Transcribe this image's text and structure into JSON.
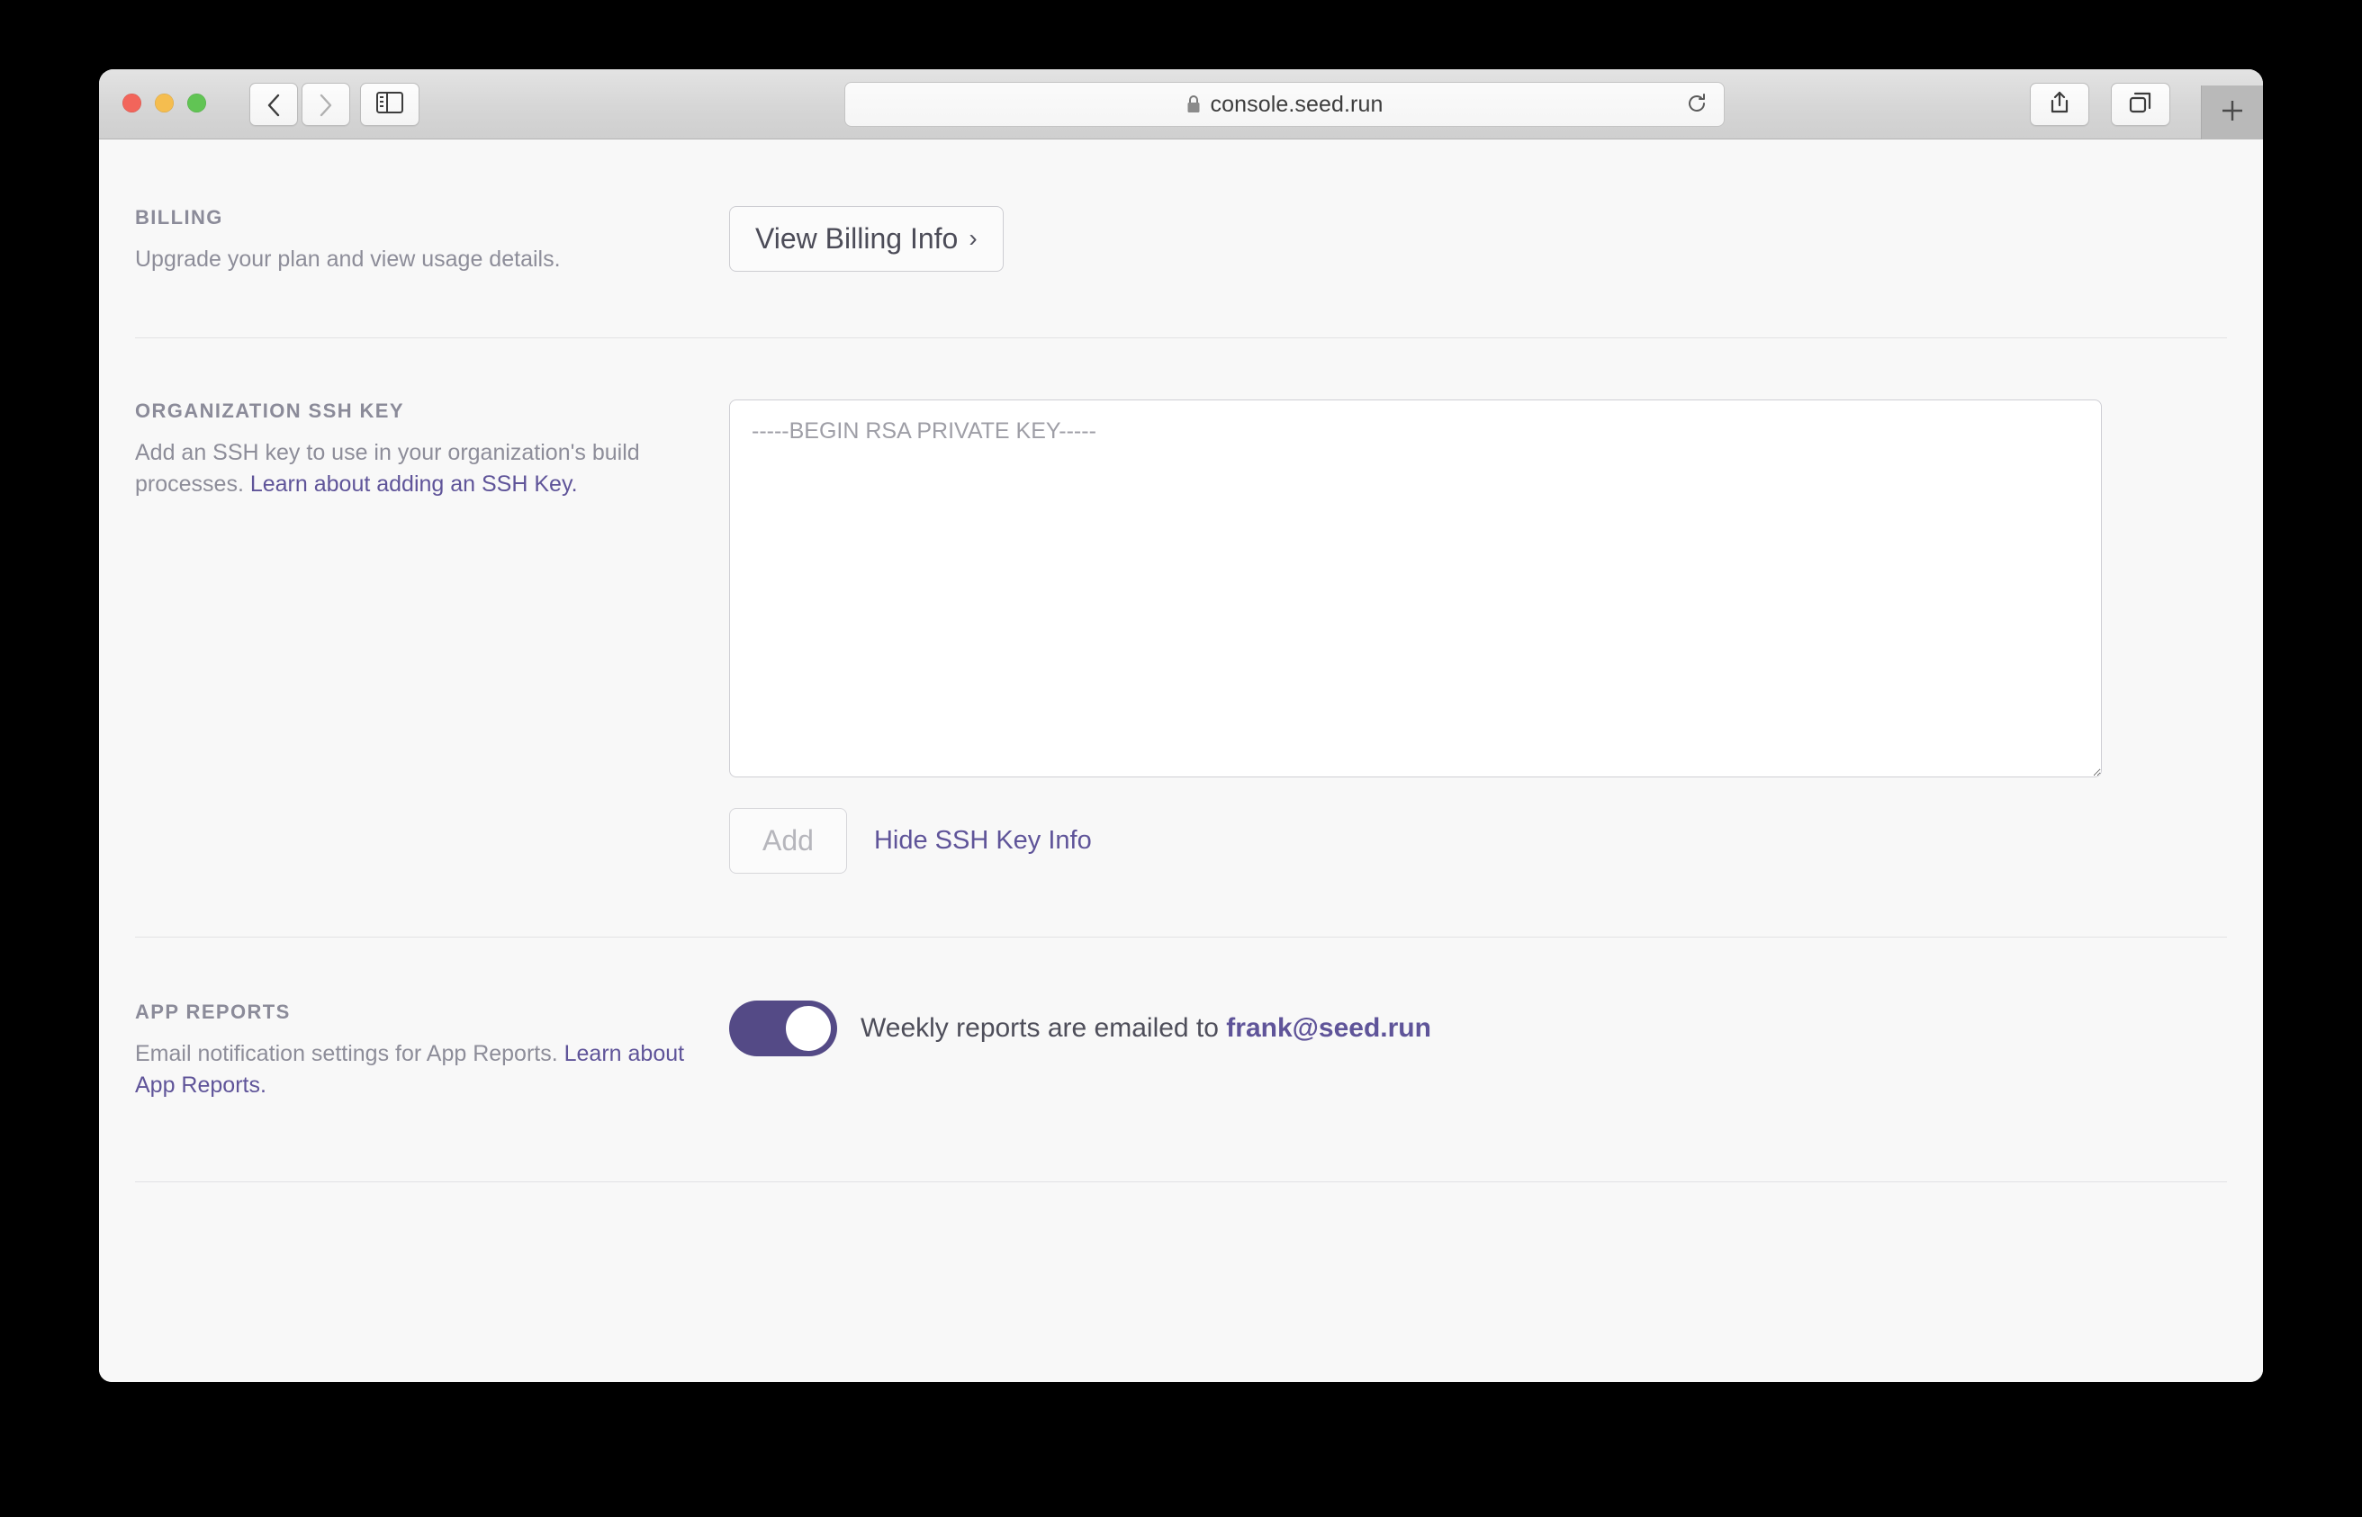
{
  "browser": {
    "url": "console.seed.run",
    "lock_icon": "lock-icon",
    "reload_icon": "reload-icon",
    "back_icon": "chevron-left-icon",
    "forward_icon": "chevron-right-icon",
    "sidebar_icon": "sidebar-toggle-icon",
    "share_icon": "share-icon",
    "tabs_icon": "tab-overview-icon",
    "new_tab_label": "+"
  },
  "theme": {
    "accent": "#5f5499",
    "toggle_on": "#544a86",
    "muted_text": "#8d8d99",
    "body_text": "#4e4e5a",
    "page_bg": "#f8f8f8",
    "divider": "#e2e2e4"
  },
  "sections": {
    "billing": {
      "title": "BILLING",
      "description": "Upgrade your plan and view usage details.",
      "button_label": "View Billing Info",
      "button_caret": "›"
    },
    "ssh": {
      "title": "ORGANIZATION SSH KEY",
      "description_text": "Add an SSH key to use in your organization's build processes. ",
      "description_link": "Learn about adding an SSH Key.",
      "textarea_placeholder": "-----BEGIN RSA PRIVATE KEY-----",
      "textarea_value": "",
      "add_label": "Add",
      "add_disabled": true,
      "hide_link_label": "Hide SSH Key Info"
    },
    "reports": {
      "title": "APP REPORTS",
      "description_text": "Email notification settings for App Reports. ",
      "description_link": "Learn about App Reports.",
      "toggle_on": true,
      "toggle_text_prefix": "Weekly reports are emailed to ",
      "toggle_email": "frank@seed.run"
    }
  }
}
